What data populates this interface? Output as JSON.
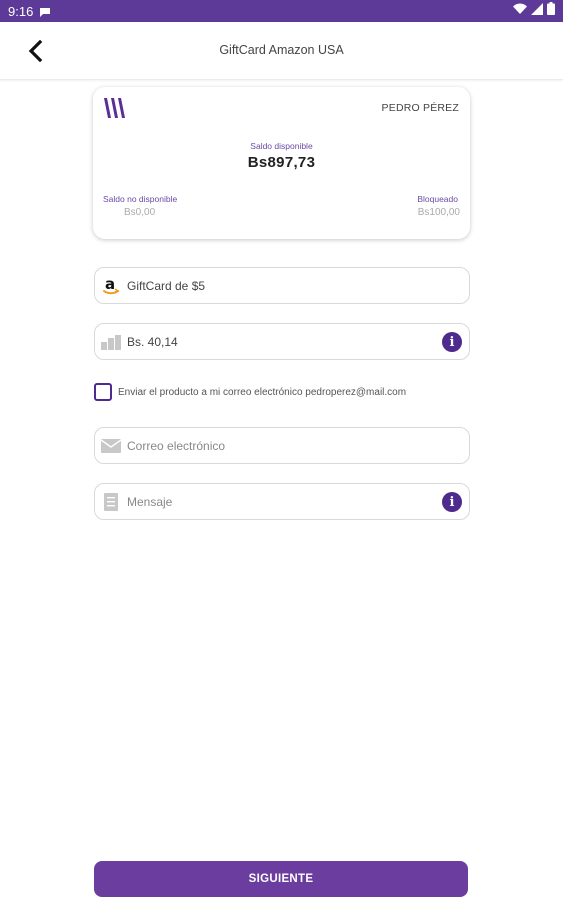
{
  "status_bar": {
    "time": "9:16"
  },
  "header": {
    "title": "GiftCard Amazon USA"
  },
  "card": {
    "holder": "PEDRO PÉREZ",
    "saldo_disponible_label": "Saldo disponible",
    "saldo_disponible_value": "Bs897,73",
    "saldo_no_disponible_label": "Saldo no disponible",
    "saldo_no_disponible_value": "Bs0,00",
    "bloqueado_label": "Bloqueado",
    "bloqueado_value": "Bs100,00"
  },
  "form": {
    "giftcard_value": "GiftCard de $5",
    "amount_value": "Bs. 40,14",
    "send_checkbox_label": "Enviar el producto a mi correo electrónico pedroperez@mail.com",
    "email_placeholder": "Correo electrónico",
    "message_placeholder": "Mensaje"
  },
  "actions": {
    "next_label": "SIGUIENTE"
  },
  "colors": {
    "primary": "#5e3a98",
    "button": "#6a3d9f",
    "accent_text": "#6b4aa6"
  }
}
